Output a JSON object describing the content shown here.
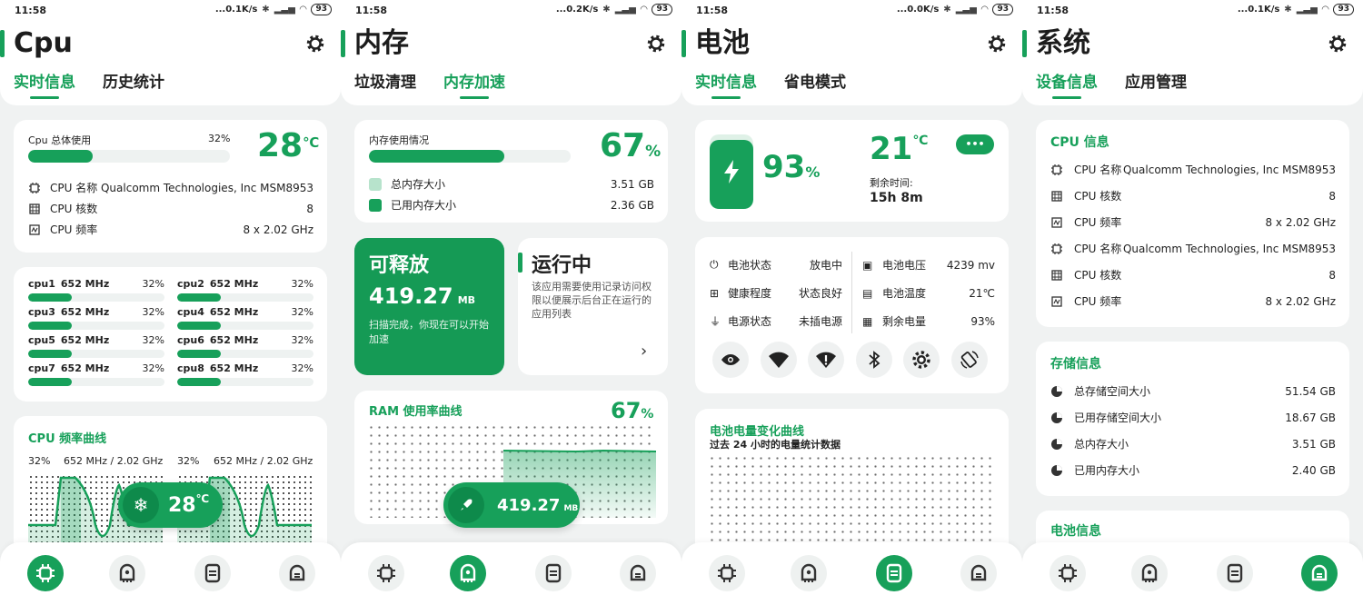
{
  "status_bars": [
    {
      "time": "11:58",
      "speed": "...0.1K/s",
      "battery": "93"
    },
    {
      "time": "11:58",
      "speed": "...0.2K/s",
      "battery": "93"
    },
    {
      "time": "11:58",
      "speed": "...0.0K/s",
      "battery": "93"
    },
    {
      "time": "11:58",
      "speed": "...0.1K/s",
      "battery": "93"
    }
  ],
  "colors": {
    "accent": "#17a05a",
    "background": "#f0f2f2",
    "card": "#ffffff"
  },
  "cpu_screen": {
    "title": "Cpu",
    "tabs": [
      "实时信息",
      "历史统计"
    ],
    "usage_label": "Cpu 总体使用",
    "usage_percent_text": "32%",
    "usage_fraction": 0.32,
    "temp_value": "28",
    "temp_unit": "℃",
    "info": [
      {
        "label": "CPU 名称",
        "value": "Qualcomm Technologies, Inc MSM8953"
      },
      {
        "label": "CPU 核数",
        "value": "8"
      },
      {
        "label": "CPU 频率",
        "value": "8 x 2.02 GHz"
      }
    ],
    "cores": [
      {
        "name": "cpu1",
        "freq": "652 MHz",
        "percent": "32%"
      },
      {
        "name": "cpu2",
        "freq": "652 MHz",
        "percent": "32%"
      },
      {
        "name": "cpu3",
        "freq": "652 MHz",
        "percent": "32%"
      },
      {
        "name": "cpu4",
        "freq": "652 MHz",
        "percent": "32%"
      },
      {
        "name": "cpu5",
        "freq": "652 MHz",
        "percent": "32%"
      },
      {
        "name": "cpu6",
        "freq": "652 MHz",
        "percent": "32%"
      },
      {
        "name": "cpu7",
        "freq": "652 MHz",
        "percent": "32%"
      },
      {
        "name": "cpu8",
        "freq": "652 MHz",
        "percent": "32%"
      }
    ],
    "core_fraction": 0.32,
    "curve_title": "CPU 频率曲线",
    "curve_left_percent": "32%",
    "curve_left_freq": "652 MHz / 2.02 GHz",
    "curve_right_percent": "32%",
    "curve_right_freq": "652 MHz / 2.02 GHz",
    "pill_temp": "28",
    "pill_unit": "℃"
  },
  "mem_screen": {
    "title": "内存",
    "tabs": [
      "垃圾清理",
      "内存加速"
    ],
    "usage_label": "内存使用情况",
    "usage_fraction": 0.67,
    "percent_value": "67",
    "percent_unit": "%",
    "total_label": "总内存大小",
    "total_value": "3.51 GB",
    "used_label": "已用内存大小",
    "used_value": "2.36 GB",
    "release_title": "可释放",
    "release_value": "419.27",
    "release_unit": "MB",
    "release_desc": "扫描完成，你现在可以开始加速",
    "running_title": "运行中",
    "running_desc": "该应用需要使用记录访问权限以便展示后台正在运行的应用列表",
    "ram_curve_title": "RAM 使用率曲线",
    "ram_curve_value": "67",
    "ram_curve_unit": "%",
    "pill_value": "419.27",
    "pill_unit": "MB"
  },
  "battery_screen": {
    "title": "电池",
    "tabs": [
      "实时信息",
      "省电模式"
    ],
    "level_value": "93",
    "level_unit": "%",
    "level_fraction": 0.93,
    "temp_value": "21",
    "temp_unit": "℃",
    "remain_label": "剩余时间:",
    "remain_value": "15h 8m",
    "more_label": "•••",
    "left_stats": [
      {
        "label": "电池状态",
        "value": "放电中"
      },
      {
        "label": "健康程度",
        "value": "状态良好"
      },
      {
        "label": "电源状态",
        "value": "未插电源"
      }
    ],
    "right_stats": [
      {
        "label": "电池电压",
        "value": "4239 mv"
      },
      {
        "label": "电池温度",
        "value": "21℃"
      },
      {
        "label": "剩余电量",
        "value": "93%"
      }
    ],
    "quick_icons": [
      "eye-icon",
      "wifi-icon",
      "wifi-off-icon",
      "bluetooth-icon",
      "brightness-icon",
      "rotate-icon"
    ],
    "curve_title": "电池电量变化曲线",
    "curve_subtitle": "过去 24 小时的电量统计数据"
  },
  "system_screen": {
    "title": "系统",
    "tabs": [
      "设备信息",
      "应用管理"
    ],
    "cpu_section_title": "CPU 信息",
    "cpu_info": [
      {
        "label": "CPU 名称",
        "value": "Qualcomm Technologies, Inc MSM8953"
      },
      {
        "label": "CPU 核数",
        "value": "8"
      },
      {
        "label": "CPU 频率",
        "value": "8 x 2.02 GHz"
      },
      {
        "label": "CPU 名称",
        "value": "Qualcomm Technologies, Inc MSM8953"
      },
      {
        "label": "CPU 核数",
        "value": "8"
      },
      {
        "label": "CPU 频率",
        "value": "8 x 2.02 GHz"
      }
    ],
    "storage_section_title": "存储信息",
    "storage_info": [
      {
        "label": "总存储空间大小",
        "value": "51.54 GB"
      },
      {
        "label": "已用存储空间大小",
        "value": "18.67 GB"
      },
      {
        "label": "总内存大小",
        "value": "3.51 GB"
      },
      {
        "label": "已用内存大小",
        "value": "2.40 GB"
      }
    ],
    "battery_section_title": "电池信息"
  },
  "nav_icons": [
    "cpu-icon",
    "memory-icon",
    "battery-icon",
    "system-icon"
  ]
}
